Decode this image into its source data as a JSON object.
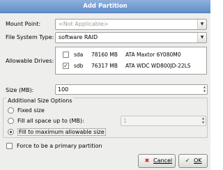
{
  "dialog": {
    "title": "Add Partition"
  },
  "mount_point": {
    "label": "Mount Point:",
    "value": "<Not Applicable>"
  },
  "file_system_type": {
    "label": "File System Type:",
    "value": "software RAID"
  },
  "allowable_drives": {
    "label": "Allowable Drives:",
    "drives": [
      {
        "checked": false,
        "name": "sda",
        "size": "78160 MB",
        "model": "ATA Maxtor 6Y080M0"
      },
      {
        "checked": true,
        "name": "sdb",
        "size": "76317 MB",
        "model": "ATA WDC WD800JD-22LS"
      }
    ]
  },
  "size": {
    "label": "Size (MB):",
    "value": "100"
  },
  "additional_options": {
    "label": "Additional Size Options",
    "fixed": {
      "label": "Fixed size",
      "selected": false
    },
    "fill_upto": {
      "label": "Fill all space up to (MB):",
      "selected": false,
      "value": "1"
    },
    "fill_max": {
      "label": "Fill to maximum allowable size",
      "selected": true
    }
  },
  "force_primary": {
    "label": "Force to be a primary partition",
    "checked": false
  },
  "buttons": {
    "cancel": {
      "label": "Cancel",
      "icon": "cancel-icon",
      "color": "#cc2222"
    },
    "ok": {
      "label": "OK",
      "icon": "ok-icon",
      "color": "#3a8f2a"
    }
  }
}
